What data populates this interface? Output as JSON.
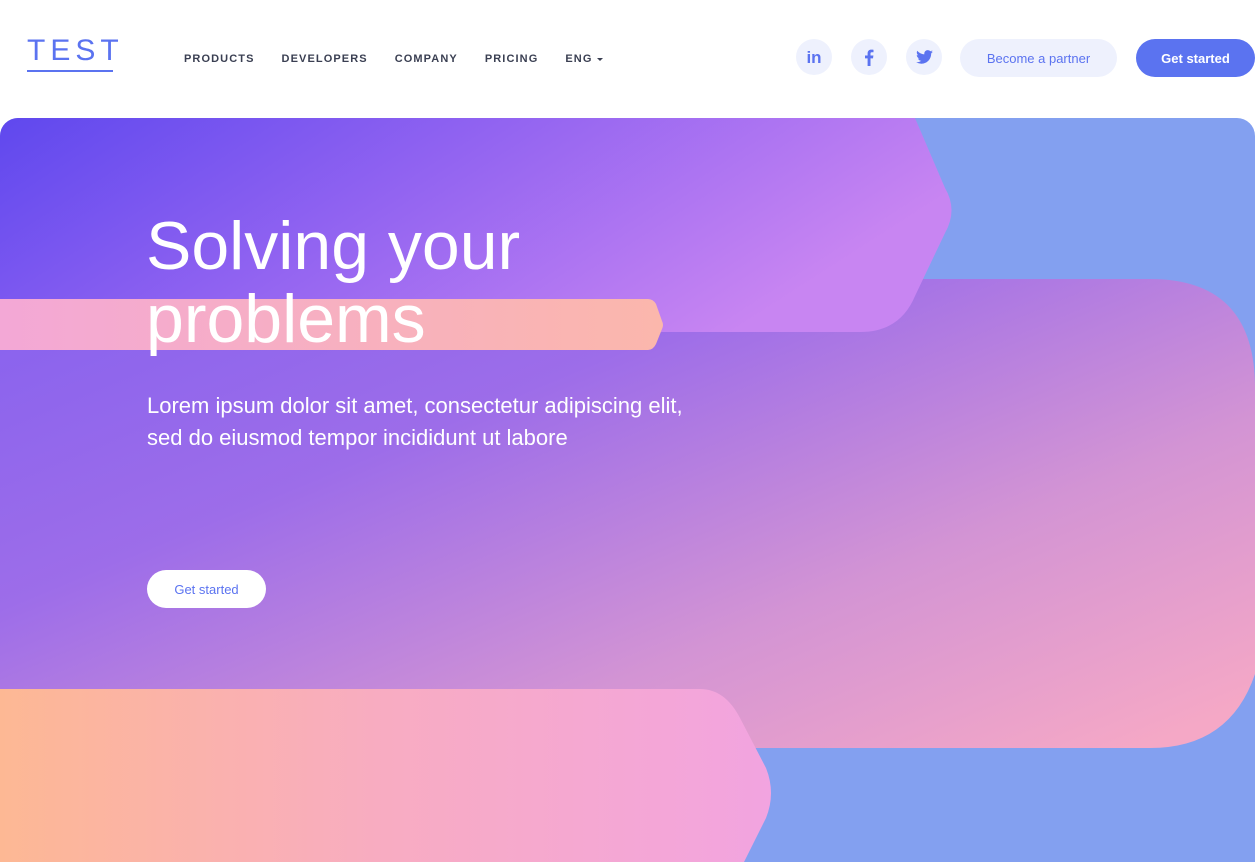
{
  "brand": {
    "logo_text": "TEST",
    "accent_color": "#5b73f0"
  },
  "nav": {
    "items": [
      {
        "label": "PRODUCTS"
      },
      {
        "label": "DEVELOPERS"
      },
      {
        "label": "COMPANY"
      },
      {
        "label": "PRICING"
      },
      {
        "label": "ENG"
      }
    ]
  },
  "social": {
    "linkedin_label": "in",
    "icons": [
      "linkedin-icon",
      "facebook-icon",
      "twitter-icon"
    ]
  },
  "header_buttons": {
    "partner_label": "Become a partner",
    "get_started_label": "Get started"
  },
  "hero": {
    "title_line1": "Solving your",
    "title_line2": "problems",
    "subtitle": "Lorem ipsum dolor sit amet, consectetur adipiscing elit, sed do eiusmod tempor incididunt ut labore",
    "cta_label": "Get started",
    "colors": {
      "base": "#83a0f0",
      "purple_start": "#5f48ee",
      "purple_end": "#c885f2",
      "pink": "#f4a8c8",
      "peach": "#fbb996"
    }
  }
}
